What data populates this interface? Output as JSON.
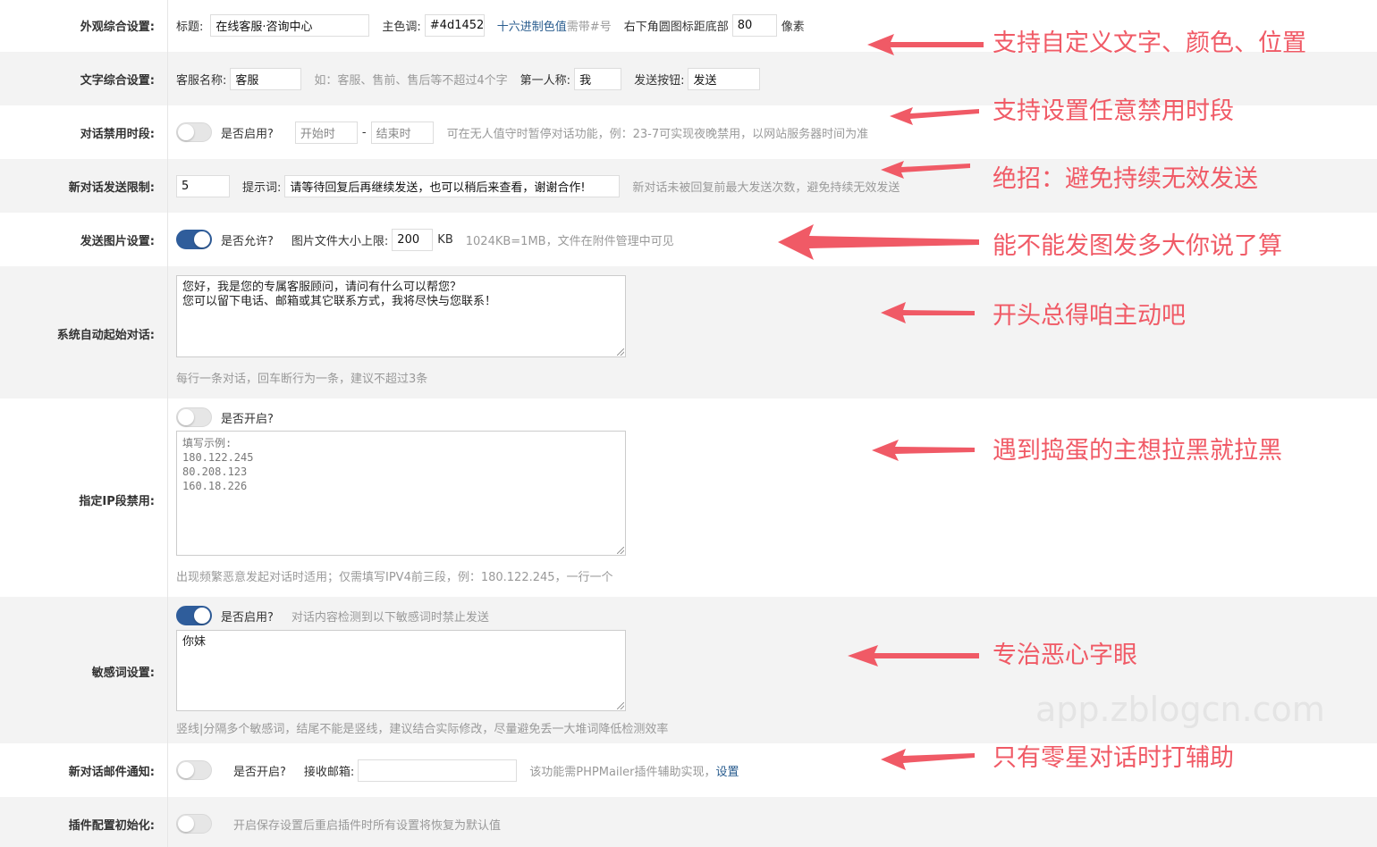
{
  "appearance": {
    "label": "外观综合设置:",
    "title_label": "标题:",
    "title_value": "在线客服·咨询中心",
    "color_label": "主色调:",
    "color_value": "#4d1452",
    "color_hint": "十六进制色值",
    "color_hint2": "需带#号",
    "offset_label": "右下角圆图标距底部",
    "offset_value": "80",
    "offset_unit": "像素"
  },
  "text_settings": {
    "label": "文字综合设置:",
    "agent_label": "客服名称:",
    "agent_value": "客服",
    "agent_hint": "如：客服、售前、售后等不超过4个字",
    "first_person_label": "第一人称:",
    "first_person_value": "我",
    "send_label": "发送按钮:",
    "send_value": "发送"
  },
  "disable_period": {
    "label": "对话禁用时段:",
    "enable_label": "是否启用?",
    "start_placeholder": "开始时",
    "dash": "-",
    "end_placeholder": "结束时",
    "hint": "可在无人值守时暂停对话功能，例：23-7可实现夜晚禁用，以网站服务器时间为准"
  },
  "send_limit": {
    "label": "新对话发送限制:",
    "value": "5",
    "prompt_label": "提示词:",
    "prompt_value": "请等待回复后再继续发送，也可以稍后来查看，谢谢合作!",
    "hint": "新对话未被回复前最大发送次数，避免持续无效发送"
  },
  "image_send": {
    "label": "发送图片设置:",
    "allow_label": "是否允许?",
    "size_label": "图片文件大小上限:",
    "size_value": "200",
    "size_unit": "KB",
    "hint": "1024KB=1MB，文件在附件管理中可见"
  },
  "auto_start": {
    "label": "系统自动起始对话:",
    "text": "您好，我是您的专属客服顾问，请问有什么可以帮您？\n您可以留下电话、邮箱或其它联系方式，我将尽快与您联系！",
    "hint": "每行一条对话，回车断行为一条，建议不超过3条"
  },
  "ip_block": {
    "label": "指定IP段禁用:",
    "enable_label": "是否开启?",
    "placeholder": "填写示例:\n180.122.245\n80.208.123\n160.18.226",
    "hint": "出现频繁恶意发起对话时适用；仅需填写IPV4前三段，例：180.122.245，一行一个"
  },
  "sensitive": {
    "label": "敏感词设置:",
    "enable_label": "是否启用?",
    "enable_hint": "对话内容检测到以下敏感词时禁止发送",
    "text": "你妹",
    "hint": "竖线|分隔多个敏感词，结尾不能是竖线，建议结合实际修改，尽量避免丢一大堆词降低检测效率"
  },
  "email_notify": {
    "label": "新对话邮件通知:",
    "enable_label": "是否开启?",
    "email_label": "接收邮箱:",
    "email_value": "",
    "hint": "该功能需PHPMailer插件辅助实现，",
    "link": "设置"
  },
  "reset": {
    "label": "插件配置初始化:",
    "hint": "开启保存设置后重启插件时所有设置将恢复为默认值"
  },
  "annotations": [
    "支持自定义文字、颜色、位置",
    "支持设置任意禁用时段",
    "绝招：避免持续无效发送",
    "能不能发图发多大你说了算",
    "开头总得咱主动吧",
    "遇到捣蛋的主想拉黑就拉黑",
    "专治恶心字眼",
    "只有零星对话时打辅助"
  ],
  "watermark": "app.zblogcn.com",
  "toggles": {
    "disable_period": false,
    "image_send": true,
    "ip_block": false,
    "sensitive": true,
    "email_notify": false,
    "reset": false
  },
  "colors": {
    "annotation": "#f05a66",
    "toggle_on": "#2f5d9b",
    "row_gray": "#f3f3f3",
    "link": "#2a5d8f"
  }
}
